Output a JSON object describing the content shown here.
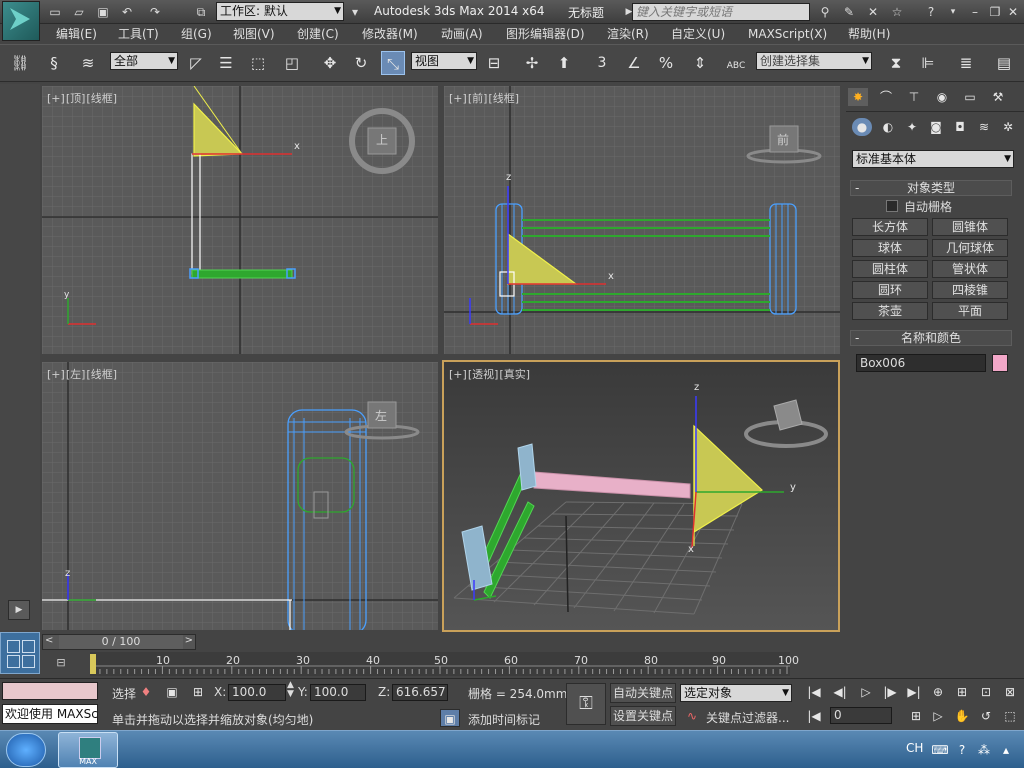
{
  "title_bar": {
    "workspace_label": "工作区: 默认",
    "app_title": "Autodesk 3ds Max  2014 x64",
    "doc_title": "无标题",
    "search_placeholder": "键入关键字或短语"
  },
  "menus": [
    "编辑(E)",
    "工具(T)",
    "组(G)",
    "视图(V)",
    "创建(C)",
    "修改器(M)",
    "动画(A)",
    "图形编辑器(D)",
    "渲染(R)",
    "自定义(U)",
    "MAXScript(X)",
    "帮助(H)"
  ],
  "toolbar": {
    "filter_select": "全部",
    "ref_coord_select": "视图",
    "snap_label": "3",
    "angle_snap_pct": "%",
    "selection_set_placeholder": "创建选择集",
    "abc_label": "ABC"
  },
  "viewports": {
    "top": {
      "label_plus": "[+]",
      "label_view": "[顶]",
      "label_mode": "[线框]",
      "cube_label": "上",
      "axis_x": "x",
      "axis_y": "y"
    },
    "front": {
      "label_plus": "[+]",
      "label_view": "[前]",
      "label_mode": "[线框]",
      "cube_label": "前",
      "axis_x": "x",
      "axis_z": "z"
    },
    "left": {
      "label_plus": "[+]",
      "label_view": "[左]",
      "label_mode": "[线框]",
      "cube_label": "左",
      "axis_z": "z"
    },
    "perspective": {
      "label_plus": "[+]",
      "label_view": "[透视]",
      "label_mode": "[真实]",
      "axis_z": "z",
      "axis_y": "y",
      "axis_x": "x"
    }
  },
  "command_panel": {
    "category_select": "标准基本体",
    "object_type_title": "对象类型",
    "auto_grid_label": "自动栅格",
    "object_buttons": [
      "长方体",
      "圆锥体",
      "球体",
      "几何球体",
      "圆柱体",
      "管状体",
      "圆环",
      "四棱锥",
      "茶壶",
      "平面"
    ],
    "name_color_title": "名称和颜色",
    "object_name": "Box006",
    "object_color": "#f2a7c8"
  },
  "timeline": {
    "frame_display": "0 / 100",
    "ticks": [
      "10",
      "20",
      "30",
      "40",
      "50",
      "60",
      "70",
      "80",
      "90",
      "100"
    ]
  },
  "status": {
    "maxscript_welcome": "欢迎使用 MAXSc",
    "selection_label": "选择",
    "x_label": "X:",
    "x_value": "100.0",
    "y_label": "Y:",
    "y_value": "100.0",
    "z_label": "Z:",
    "z_value": "616.657",
    "grid_label": "栅格 = 254.0mm",
    "prompt": "单击并拖动以选择并缩放对象(均匀地)",
    "add_time_tag": "添加时间标记",
    "auto_key": "自动关键点",
    "set_key": "设置关键点",
    "key_mode_select": "选定对象",
    "key_filters": "关键点过滤器...",
    "current_frame": "0"
  },
  "taskbar": {
    "app_button": "MAX",
    "lang": "CH"
  },
  "colors": {
    "selection_yellow": "#f0f04a",
    "green_bars": "#2ea82e",
    "blue_wire": "#4aa0ff",
    "pink_bar": "#e8b0c8",
    "viewport_border_active": "#c9a15a"
  }
}
